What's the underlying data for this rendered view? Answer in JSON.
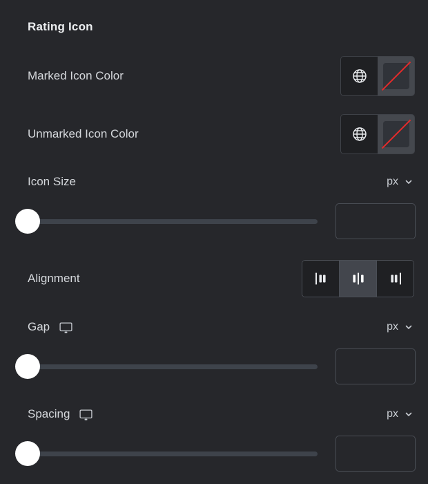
{
  "panel": {
    "section_title": "Rating Icon",
    "background_color": "#26272b"
  },
  "controls": {
    "marked_icon_color": {
      "label": "Marked Icon Color",
      "globe_icon": "globe-icon",
      "swatch_state": "no-color",
      "swatch_slash_color": "#e02b2b"
    },
    "unmarked_icon_color": {
      "label": "Unmarked Icon Color",
      "globe_icon": "globe-icon",
      "swatch_state": "no-color",
      "swatch_slash_color": "#e02b2b"
    },
    "icon_size": {
      "label": "Icon Size",
      "unit": "px",
      "value": "",
      "placeholder": "",
      "slider_position_percent": 0
    },
    "alignment": {
      "label": "Alignment",
      "options": [
        {
          "name": "align-left",
          "label": "Left"
        },
        {
          "name": "align-center",
          "label": "Center"
        },
        {
          "name": "align-right",
          "label": "Right"
        }
      ],
      "selected": "align-center"
    },
    "gap": {
      "label": "Gap",
      "device": "desktop",
      "unit": "px",
      "value": "",
      "placeholder": "",
      "slider_position_percent": 0
    },
    "spacing": {
      "label": "Spacing",
      "device": "desktop",
      "unit": "px",
      "value": "",
      "placeholder": "",
      "slider_position_percent": 0
    }
  }
}
